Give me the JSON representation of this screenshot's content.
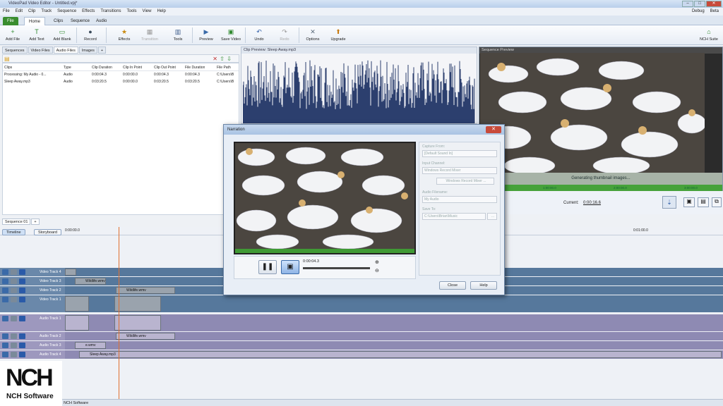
{
  "window": {
    "title": "VideoPad Video Editor - Untitled.vpj*",
    "buttons": [
      "–",
      "□",
      "✕"
    ]
  },
  "menu": {
    "items": [
      "File",
      "Edit",
      "Clip",
      "Track",
      "Sequence",
      "Effects",
      "Transitions",
      "Tools",
      "View",
      "Help"
    ],
    "right": [
      "Debug",
      "Beta"
    ]
  },
  "ribbon_tabs": [
    "File",
    "Home",
    "Clips",
    "Sequence",
    "Audio"
  ],
  "toolbar": [
    {
      "label": "Add File",
      "icon": "+",
      "color": "#2f8a2f"
    },
    {
      "label": "Add Text",
      "icon": "T",
      "color": "#2f8a2f"
    },
    {
      "label": "Add Blank",
      "icon": "▭",
      "color": "#2f8a2f"
    },
    {
      "label": "Record",
      "icon": "●",
      "color": "#3a4a5a"
    },
    {
      "label": "Effects",
      "icon": "★",
      "color": "#c98a10"
    },
    {
      "label": "Transition",
      "icon": "▦",
      "color": "#999"
    },
    {
      "label": "Tools",
      "icon": "▥",
      "color": "#3a5a8a"
    },
    {
      "label": "Preview",
      "icon": "▶",
      "color": "#3a6aa8"
    },
    {
      "label": "Save Video",
      "icon": "▣",
      "color": "#2f8a2f"
    },
    {
      "label": "Undo",
      "icon": "↶",
      "color": "#2f5ea8"
    },
    {
      "label": "Redo",
      "icon": "↷",
      "color": "#999"
    },
    {
      "label": "Options",
      "icon": "✕",
      "color": "#5a6a7a"
    },
    {
      "label": "Upgrade",
      "icon": "⬆",
      "color": "#c77a10"
    },
    {
      "label": "NCH Suite",
      "icon": "⌂",
      "color": "#2f8a2f"
    }
  ],
  "bin": {
    "tabs": [
      "Sequences",
      "Video Files",
      "Audio Files",
      "Images",
      "+"
    ],
    "columns": [
      "Clips",
      "Type",
      "Clip Duration",
      "Clip In Point",
      "Clip Out Point",
      "File Duration",
      "File Path"
    ],
    "rows": [
      [
        "Processing: My Audio - 0...",
        "Audio",
        "0:00:04.3",
        "0:00:00.0",
        "0:00:04.3",
        "0:00:04.3",
        "C:\\Users\\B"
      ],
      [
        "Sleep Away.mp3",
        "Audio",
        "0:03:20.5",
        "0:00:00.0",
        "0:03:20.5",
        "0:03:20.5",
        "C:\\Users\\B"
      ]
    ]
  },
  "clip_preview": {
    "title": "Clip Preview: Sleep Away.mp3"
  },
  "sequence_preview": {
    "title": "Sequence Preview",
    "status": "Generating thumbnail images...",
    "current_label": "Current:",
    "current_value": "0:00:16.6",
    "ruler": [
      "1:00:00.0",
      "2:00:00.0",
      "3:00:00.0"
    ]
  },
  "timeline": {
    "sequence_tab": "Sequence 01",
    "timeline_btn": "Timeline",
    "storyboard_btn": "Storyboard",
    "ruler_left": "0:00:00.0",
    "ruler_right": "0:01:00.0",
    "video_tracks": [
      {
        "name": "Video Track 4",
        "clips": [
          {
            "label": "Intro",
            "offset": 0,
            "length": 12
          }
        ]
      },
      {
        "name": "Video Track 3",
        "clips": [
          {
            "label": "Wildlife.wmv",
            "offset": 14,
            "length": 44
          }
        ]
      },
      {
        "name": "Video Track 2",
        "clips": [
          {
            "label": "Wildlife.wmv",
            "offset": 72,
            "length": 84
          }
        ]
      },
      {
        "name": "Video Track 1",
        "clips": [
          {
            "label": "",
            "offset": 0,
            "length": 34
          },
          {
            "label": "",
            "offset": 70,
            "length": 66
          }
        ]
      }
    ],
    "audio_tracks": [
      {
        "name": "Audio Track 1",
        "clips": [
          {
            "label": "",
            "offset": 0,
            "length": 34
          },
          {
            "label": "",
            "offset": 70,
            "length": 66
          }
        ]
      },
      {
        "name": "Audio Track 2",
        "clips": [
          {
            "label": "Wildlife.wmv",
            "offset": 72,
            "length": 84
          }
        ]
      },
      {
        "name": "Audio Track 3",
        "clips": [
          {
            "label": "e.wmv",
            "offset": 14,
            "length": 44
          }
        ]
      },
      {
        "name": "Audio Track 4",
        "clips": [
          {
            "label": "Sleep Away.mp3",
            "offset": 20,
            "length": 910
          }
        ]
      }
    ]
  },
  "narration": {
    "title": "Narration",
    "time": "0:00:04.3",
    "capture_label": "Capture From:",
    "capture_value": "[Default Sound In]",
    "input_label": "Input Channel:",
    "input_value": "Windows Record Mixer",
    "mixer_button": "Windows Record Mixer ...",
    "audio_label": "Audio Filename:",
    "audio_value": "My Audio",
    "save_label": "Save To:",
    "save_value": "C:\\Users\\Brian\\Music",
    "browse": "...",
    "close": "Close",
    "help": "Help"
  },
  "status": "NCH Software",
  "logo": {
    "big": "NCH",
    "sub": "NCH Software"
  }
}
